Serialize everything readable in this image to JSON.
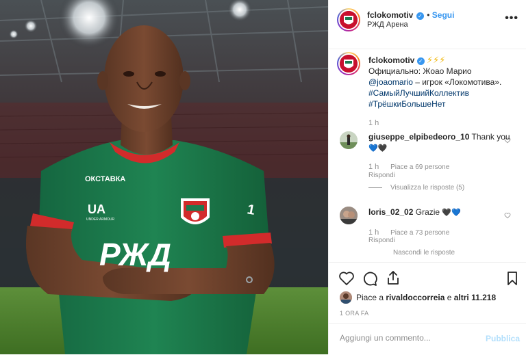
{
  "post": {
    "username": "fclokomotiv",
    "follow_label": "Segui",
    "location": "РЖД Арена",
    "more_label": "•••"
  },
  "caption": {
    "username": "fclokomotiv",
    "emojis": "⚡⚡⚡",
    "line1": "Официально: Жоао Марио",
    "mention": "@joaomario",
    "line2_rest": " – игрок «Локомотива».",
    "hashtag1": "#СамыйЛучшийКоллектив",
    "hashtag2": "#ТрёшкиБольшеНет",
    "time": "1 h"
  },
  "comments": [
    {
      "username": "giuseppe_elpibedeoro_10",
      "text": "Thank you",
      "emojis": "💙🖤",
      "time": "1 h",
      "likes": "Piace a 69 persone",
      "reply": "Rispondi",
      "replies_toggle": "Visualizza le risposte (5)"
    },
    {
      "username": "loris_02_02",
      "text": "Grazie",
      "emojis": "🖤💙",
      "time": "1 h",
      "likes": "Piace a 73 persone",
      "reply": "Rispondi",
      "replies_toggle": "Nascondi le risposte"
    }
  ],
  "likes_summary": {
    "prefix": "Piace a ",
    "user": "rivaldoccorreia",
    "middle": " e ",
    "others": "altri 11.218"
  },
  "posted_ago": "1 ORA FA",
  "add_comment": {
    "placeholder": "Aggiungi un commento...",
    "publish_label": "Pubblica"
  },
  "jersey": {
    "sponsor_chest": "РЖД",
    "sponsor_kit": "ОКСТАВКА",
    "brand": "UNDER ARMOUR"
  },
  "colors": {
    "link": "#00376b",
    "accent": "#3897f0",
    "jersey_green": "#1d7a4f",
    "jersey_red": "#d22b2b"
  }
}
